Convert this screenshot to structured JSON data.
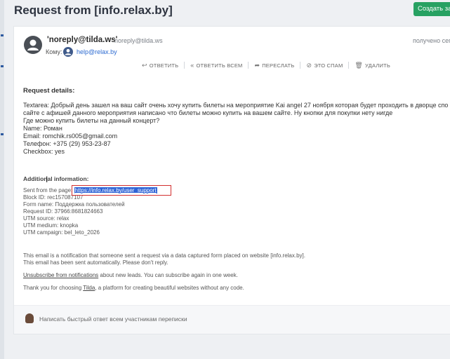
{
  "header": {
    "title": "Request from [info.relax.by]",
    "create_button": "Создать зада"
  },
  "message": {
    "sender_name": "'noreply@tilda.ws'",
    "sender_email": "noreply@tilda.ws",
    "received_label": "получено сего",
    "to_label": "Кому:",
    "to_address": "help@relax.by"
  },
  "actions": {
    "reply": "ОТВЕТИТЬ",
    "reply_all": "ОТВЕТИТЬ ВСЕМ",
    "forward": "ПЕРЕСЛАТЬ",
    "spam": "ЭТО СПАМ",
    "delete": "УДАЛИТЬ"
  },
  "body": {
    "request_heading": "Request details:",
    "lines": [
      "Textarea: Добрый день зашел на ваш сайт очень хочу купить билеты на мероприятие Kai angel 27 ноября которая будет проходить в дворце спо",
      "сайте с афишей данного мероприятия написано что билеты можно купить на вашем сайте. Ну кнопки для покупки нету нигде",
      "Где можно купить билеты на данный концерт?",
      "Name: Роман",
      "Email: romchik.rs005@gmail.com",
      "Телефон: +375 (29) 953-23-87",
      "Checkbox: yes"
    ],
    "additional_heading": "Additional information:",
    "sent_from_label": "Sent from the page:",
    "sent_from_link": "https://info.relax.by/user_support",
    "meta_lines": [
      "Block ID: rec157087107",
      "Form name: Поддержка пользователей",
      "Request ID: 37966:8681824663",
      "UTM source: relax",
      "UTM medium: knopka",
      "UTM campaign: bel_leto_2026"
    ],
    "notice_line1": "This email is a notification that someone sent a request via a data captured form placed on website [info.relax.by].",
    "notice_line2": "This email has been sent automatically. Please don't reply.",
    "unsubscribe_link": "Unsubscribe from notifications",
    "unsubscribe_rest": " about new leads. You can subscribe again in one week.",
    "thanks_prefix": "Thank you for choosing ",
    "thanks_link": "Tilda",
    "thanks_suffix": ", a platform for creating beautiful websites without any code."
  },
  "reply_bar": {
    "placeholder": "Написать быстрый ответ всем участникам переписки"
  }
}
